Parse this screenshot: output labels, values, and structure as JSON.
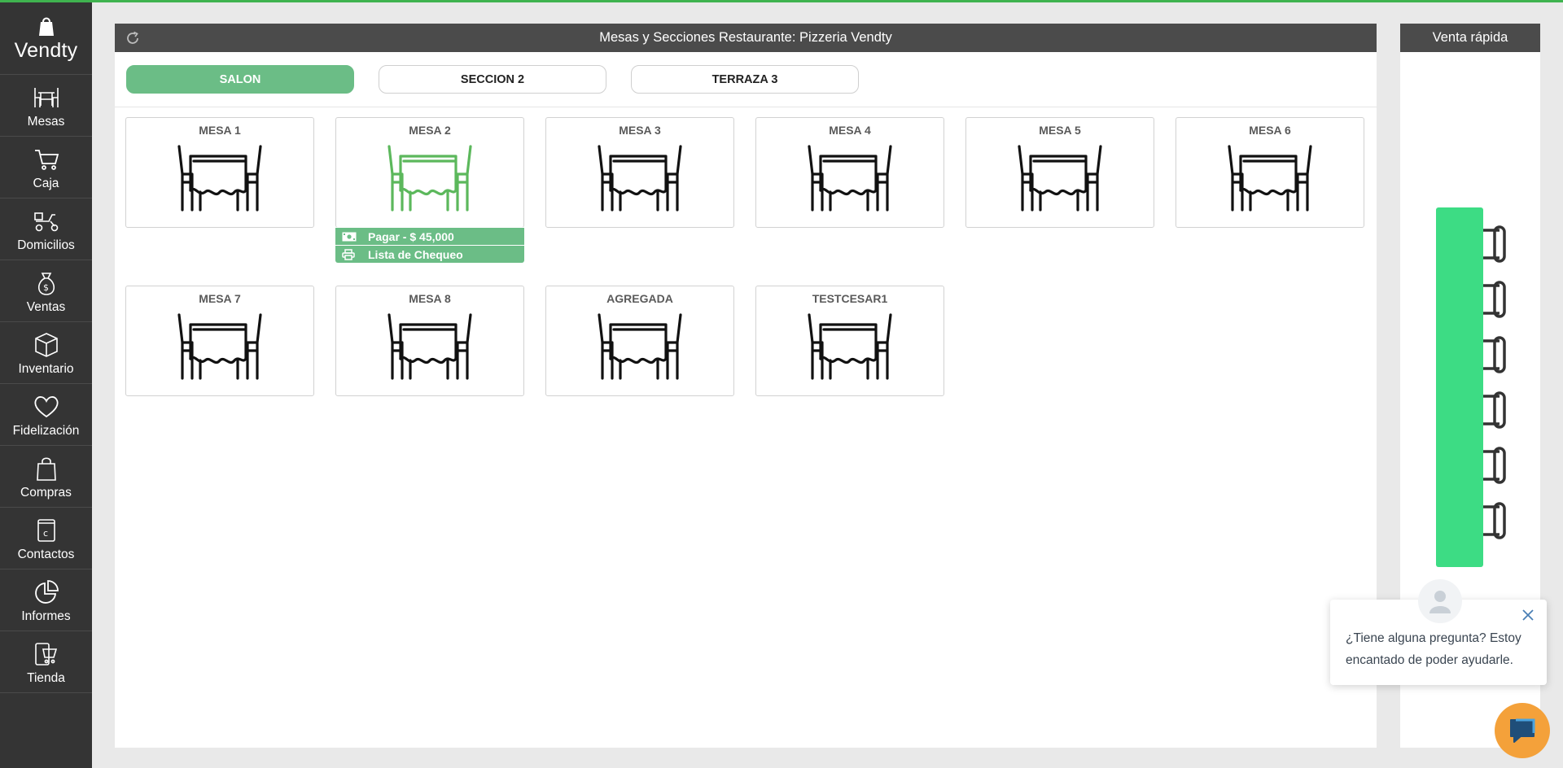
{
  "brand": {
    "name": "Vendty"
  },
  "sidebar": {
    "items": [
      {
        "label": "Mesas",
        "icon": "table-icon"
      },
      {
        "label": "Caja",
        "icon": "cart-icon"
      },
      {
        "label": "Domicilios",
        "icon": "scooter-icon"
      },
      {
        "label": "Ventas",
        "icon": "money-bag-icon"
      },
      {
        "label": "Inventario",
        "icon": "box-icon"
      },
      {
        "label": "Fidelización",
        "icon": "heart-icon"
      },
      {
        "label": "Compras",
        "icon": "shopping-bag-icon"
      },
      {
        "label": "Contactos",
        "icon": "contacts-book-icon"
      },
      {
        "label": "Informes",
        "icon": "pie-chart-icon"
      },
      {
        "label": "Tienda",
        "icon": "store-phone-icon"
      }
    ]
  },
  "main": {
    "title": "Mesas y Secciones Restaurante: Pizzeria Vendty",
    "tabs": [
      {
        "label": "SALON",
        "active": true
      },
      {
        "label": "SECCION 2",
        "active": false
      },
      {
        "label": "TERRAZA 3",
        "active": false
      }
    ],
    "tables": [
      {
        "name": "MESA 1",
        "occupied": false
      },
      {
        "name": "MESA 2",
        "occupied": true,
        "pay_label": "Pagar - $ 45,000",
        "checklist_label": "Lista de Chequeo"
      },
      {
        "name": "MESA 3",
        "occupied": false
      },
      {
        "name": "MESA 4",
        "occupied": false
      },
      {
        "name": "MESA 5",
        "occupied": false
      },
      {
        "name": "MESA 6",
        "occupied": false
      },
      {
        "name": "MESA 7",
        "occupied": false
      },
      {
        "name": "MESA 8",
        "occupied": false
      },
      {
        "name": "AGREGADA",
        "occupied": false
      },
      {
        "name": "TESTCESAR1",
        "occupied": false
      }
    ]
  },
  "quick_sale": {
    "title": "Venta rápida"
  },
  "chat": {
    "message": "¿Tiene alguna pregunta? Estoy encantado de poder ayudarle."
  },
  "colors": {
    "accent": "#6bbd86",
    "sidebar": "#343434",
    "header": "#4b4b4b",
    "occupied_table": "#5cb85c",
    "notebook": "#3ddc84",
    "chat_button": "#f4a13a"
  }
}
